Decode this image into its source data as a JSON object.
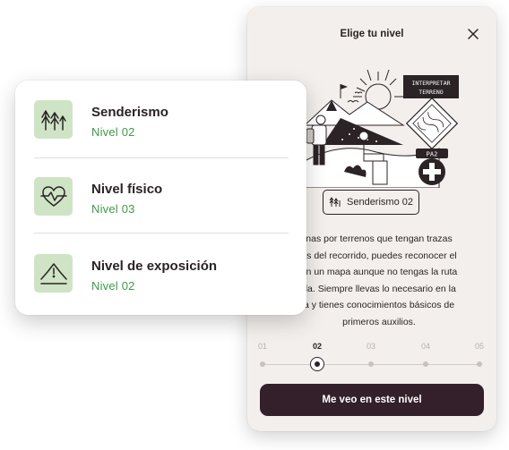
{
  "modal": {
    "title": "Elige tu nivel",
    "illustration": {
      "sign_line1": "INTERPRETAR",
      "sign_line2": "TERRENO",
      "badge_text": "PA2"
    },
    "badge_label": "Senderismo 02",
    "description": "…nas por terrenos que tengan trazas …es del recorrido, puedes reconocer el …en un mapa aunque no tengas la ruta …da. Siempre llevas lo necesario en la …a y tienes conocimientos básicos de primeros auxilios.",
    "description_lines": [
      "nas por terrenos que tengan trazas",
      "es del recorrido, puedes reconocer el",
      "en un mapa aunque no tengas la ruta",
      "da. Siempre llevas lo necesario en la",
      "a y tienes conocimientos básicos de",
      "primeros auxilios."
    ],
    "steps": [
      "01",
      "02",
      "03",
      "04",
      "05"
    ],
    "selected_step": "02",
    "cta_label": "Me veo en este nivel"
  },
  "card": {
    "items": [
      {
        "label": "Senderismo",
        "level": "Nivel 02",
        "icon": "forest-icon"
      },
      {
        "label": "Nivel físico",
        "level": "Nivel 03",
        "icon": "heart-pulse-icon"
      },
      {
        "label": "Nivel de exposición",
        "level": "Nivel 02",
        "icon": "warning-mountain-icon"
      }
    ]
  },
  "colors": {
    "modal_bg": "#f3efec",
    "dark": "#2b2326",
    "cta_bg": "#33202a",
    "accent_green": "#3f9a45",
    "icon_bg": "#cfe4c5"
  }
}
